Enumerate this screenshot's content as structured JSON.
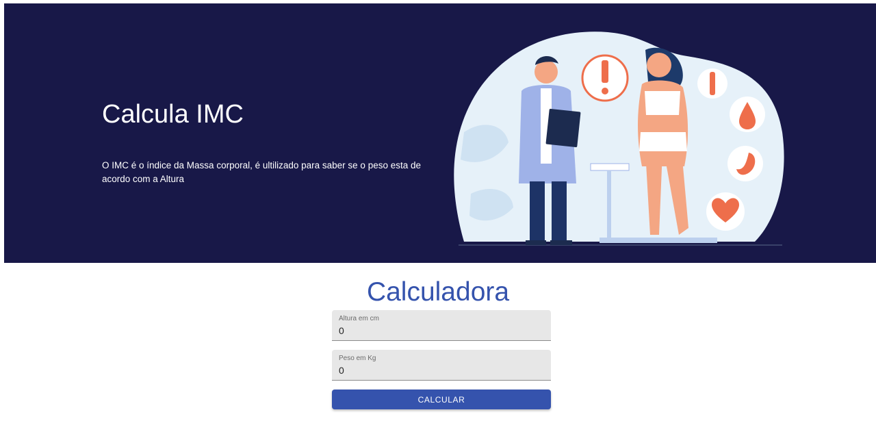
{
  "hero": {
    "title": "Calcula IMC",
    "description": "O IMC é o índice da Massa corporal, é ultilizado para saber se o peso esta de acordo com a Altura"
  },
  "calculator": {
    "title": "Calculadora",
    "height_field": {
      "label": "Altura em cm",
      "value": "0"
    },
    "weight_field": {
      "label": "Peso em Kg",
      "value": "0"
    },
    "button_label": "CALCULAR"
  },
  "colors": {
    "hero_background": "#181848",
    "accent": "#3553ad",
    "field_background": "#e7e7e7"
  }
}
